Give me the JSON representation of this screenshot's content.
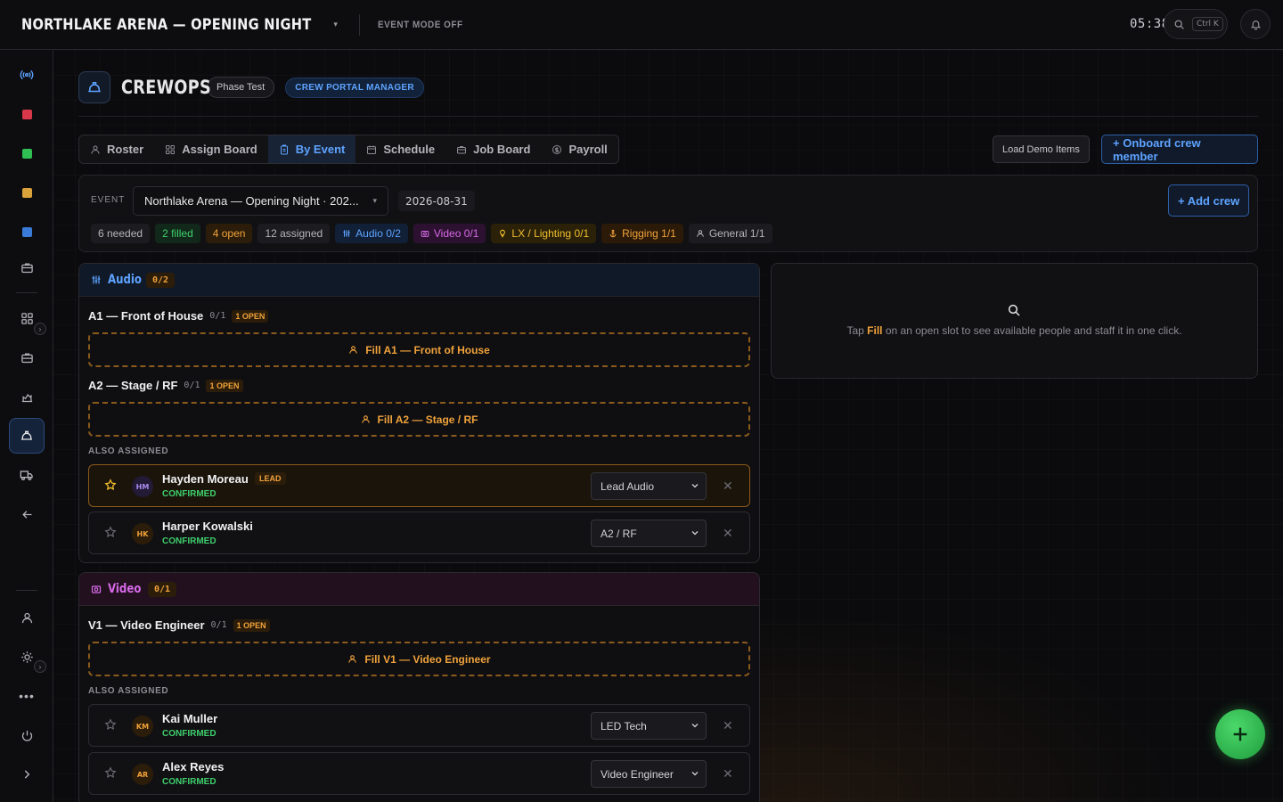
{
  "topbar": {
    "title": "NORTHLAKE ARENA — OPENING NIGHT",
    "mode": "EVENT MODE OFF",
    "clock": "05:38",
    "search_shortcut": "Ctrl K"
  },
  "header": {
    "brand": "CREWOPS",
    "phase_chip": "Phase Test",
    "role_chip": "CREW PORTAL MANAGER"
  },
  "tabs": [
    {
      "label": "Roster",
      "icon": "user-icon",
      "active": false
    },
    {
      "label": "Assign Board",
      "icon": "grid-icon",
      "active": false
    },
    {
      "label": "By Event",
      "icon": "clipboard-icon",
      "active": true
    },
    {
      "label": "Schedule",
      "icon": "calendar-icon",
      "active": false
    },
    {
      "label": "Job Board",
      "icon": "briefcase-icon",
      "active": false
    },
    {
      "label": "Payroll",
      "icon": "dollar-icon",
      "active": false
    }
  ],
  "actions": {
    "load_demo": "Load Demo Items",
    "onboard": "+ Onboard crew member",
    "add_crew": "+ Add crew"
  },
  "event": {
    "label": "EVENT",
    "selected": "Northlake Arena — Opening Night · 202...",
    "date": "2026-08-31",
    "stats": {
      "needed": "6 needed",
      "filled": "2 filled",
      "open": "4 open",
      "assigned": "12 assigned",
      "audio": "Audio 0/2",
      "video": "Video 0/1",
      "lighting": "LX / Lighting 0/1",
      "rigging": "Rigging 1/1",
      "general": "General 1/1"
    }
  },
  "audio": {
    "name": "Audio",
    "count": "0/2",
    "slots": [
      {
        "name": "A1 — Front of House",
        "ratio": "0/1",
        "badge": "1 OPEN",
        "fill": "Fill A1 — Front of House"
      },
      {
        "name": "A2 — Stage / RF",
        "ratio": "0/1",
        "badge": "1 OPEN",
        "fill": "Fill A2 — Stage / RF"
      }
    ],
    "also_label": "ALSO ASSIGNED",
    "people": [
      {
        "initials": "HM",
        "name": "Hayden Moreau",
        "badge": "LEAD",
        "status": "CONFIRMED",
        "role": "Lead Audio"
      },
      {
        "initials": "HK",
        "name": "Harper Kowalski",
        "status": "CONFIRMED",
        "role": "A2 / RF"
      }
    ]
  },
  "video": {
    "name": "Video",
    "count": "0/1",
    "slots": [
      {
        "name": "V1 — Video Engineer",
        "ratio": "0/1",
        "badge": "1 OPEN",
        "fill": "Fill V1 — Video Engineer"
      }
    ],
    "also_label": "ALSO ASSIGNED",
    "people": [
      {
        "initials": "KM",
        "name": "Kai Muller",
        "status": "CONFIRMED",
        "role": "LED Tech"
      },
      {
        "initials": "AR",
        "name": "Alex Reyes",
        "status": "CONFIRMED",
        "role": "Video Engineer"
      }
    ]
  },
  "info": {
    "pre": "Tap",
    "emph": "Fill",
    "post": "on an open slot to see available people and staff it in one click."
  },
  "colors": {
    "accent_blue": "#5ea3ff",
    "open_orange": "#f0a23a",
    "confirmed_green": "#3fcf6b",
    "video_pink": "#d86ae8",
    "fab_green": "#2fbf52"
  }
}
